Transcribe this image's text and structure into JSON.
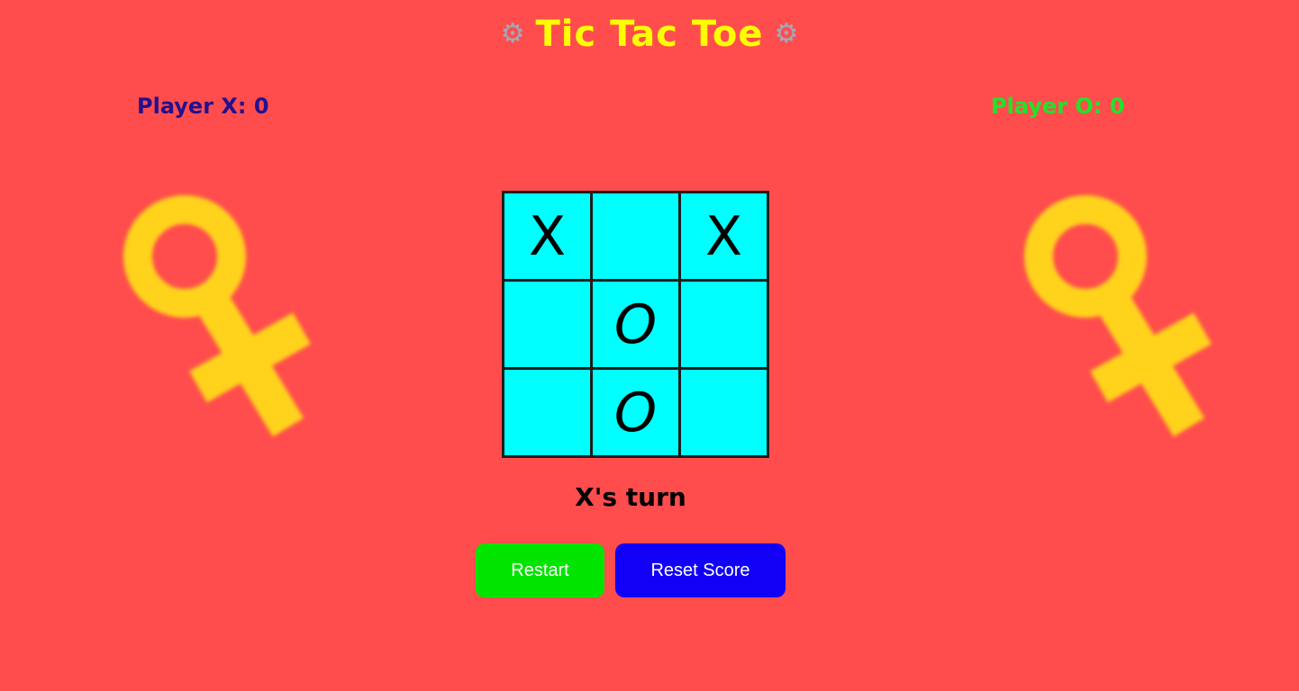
{
  "title": "Tic Tac Toe",
  "title_icon": "gear-icon",
  "scores": {
    "x": {
      "label": "Player X: 0",
      "color": "#24108c"
    },
    "o": {
      "label": "Player O: 0",
      "color": "#22e22a"
    }
  },
  "board": {
    "cells": [
      "X",
      "",
      "X",
      "",
      "O",
      "",
      "",
      "O",
      ""
    ]
  },
  "status": "X's turn",
  "buttons": {
    "restart": "Restart",
    "reset_score": "Reset Score"
  },
  "decorations": {
    "mascot_icon": "female-symbol-icon",
    "mascot_color": "#ffd21f"
  },
  "colors": {
    "background": "#ff4d4d",
    "title": "#ffff00",
    "cell": "#00ffff",
    "restart": "#00e400",
    "reset": "#1100f5"
  }
}
